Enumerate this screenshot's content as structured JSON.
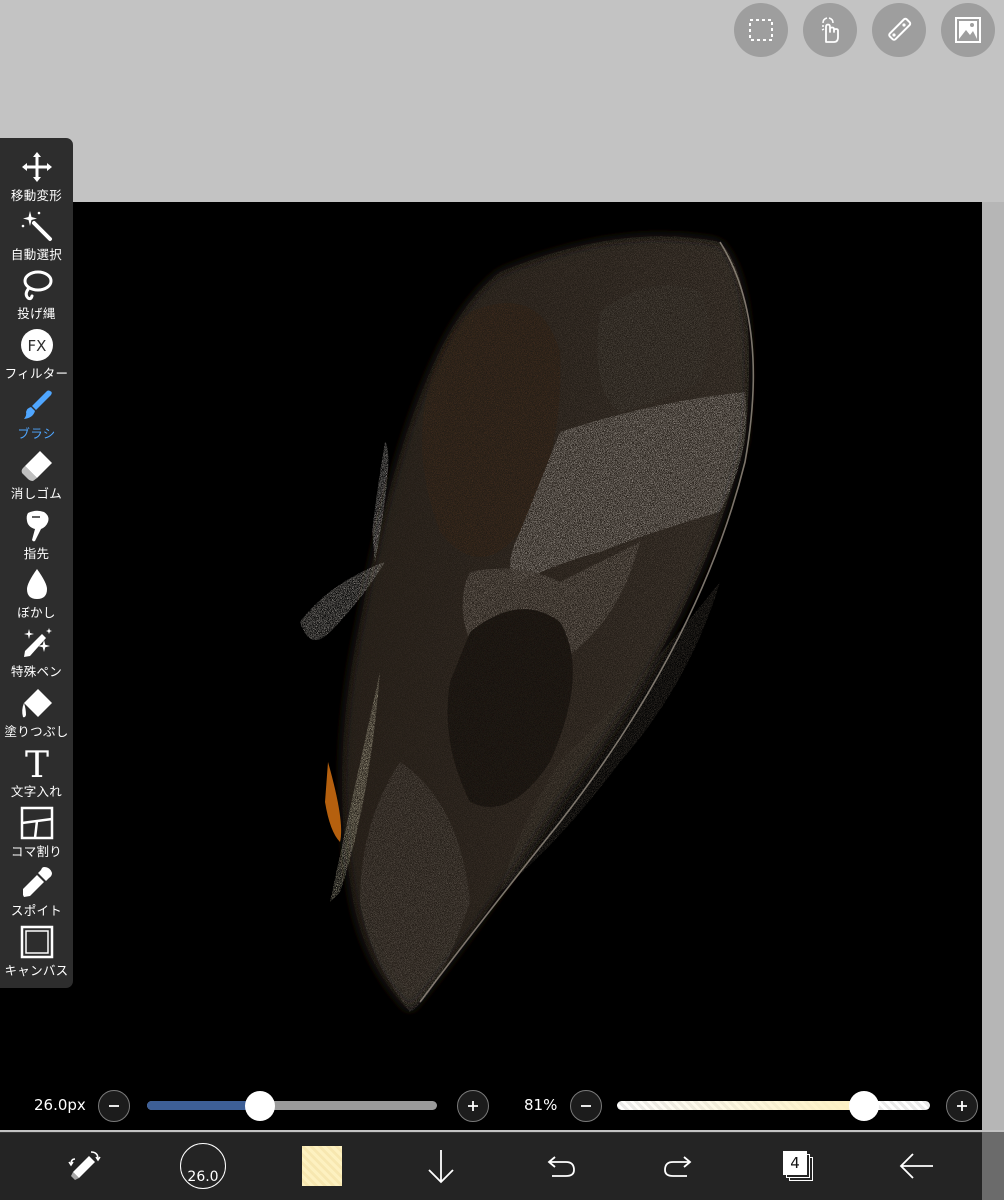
{
  "toolbar": {
    "tools": [
      {
        "id": "move",
        "label": "移動変形",
        "icon": "move-arrows-icon"
      },
      {
        "id": "magic",
        "label": "自動選択",
        "icon": "magic-wand-icon"
      },
      {
        "id": "lasso",
        "label": "投げ縄",
        "icon": "lasso-icon"
      },
      {
        "id": "filter",
        "label": "フィルター",
        "icon": "fx-icon",
        "glyph": "FX"
      },
      {
        "id": "brush",
        "label": "ブラシ",
        "icon": "brush-icon",
        "active": true
      },
      {
        "id": "eraser",
        "label": "消しゴム",
        "icon": "eraser-icon"
      },
      {
        "id": "smudge",
        "label": "指先",
        "icon": "finger-icon"
      },
      {
        "id": "blur",
        "label": "ぼかし",
        "icon": "drop-icon"
      },
      {
        "id": "special",
        "label": "特殊ペン",
        "icon": "sparkle-pen-icon"
      },
      {
        "id": "fill",
        "label": "塗りつぶし",
        "icon": "bucket-icon"
      },
      {
        "id": "text",
        "label": "文字入れ",
        "icon": "text-icon",
        "glyph": "T"
      },
      {
        "id": "panel",
        "label": "コマ割り",
        "icon": "frame-divider-icon"
      },
      {
        "id": "dropper",
        "label": "スポイト",
        "icon": "eyedropper-icon"
      },
      {
        "id": "canvas",
        "label": "キャンバス",
        "icon": "canvas-icon"
      }
    ]
  },
  "top_buttons": [
    {
      "id": "selection",
      "icon": "selection-rect-icon"
    },
    {
      "id": "gesture",
      "icon": "touch-gesture-icon"
    },
    {
      "id": "ruler",
      "icon": "ruler-icon"
    },
    {
      "id": "material",
      "icon": "image-material-icon"
    }
  ],
  "brush_size": {
    "label": "26.0px",
    "value": 26.0,
    "fraction": 0.39
  },
  "opacity": {
    "label": "81%",
    "value": 81,
    "fraction": 0.79
  },
  "bottom_bar": {
    "brush_preview_label": "26.0",
    "layer_count": "4",
    "primary_color": "#fdf1c0",
    "items": [
      "swap-color-icon",
      "brush-size-preview",
      "color-swatch",
      "save-down-icon",
      "undo-icon",
      "redo-icon",
      "layers-icon",
      "back-icon"
    ]
  },
  "colors": {
    "accent": "#4fa6ff",
    "size_fill": "#3d5f97",
    "track": "#9a9a9a",
    "opacity_fill": "#fdf1c0"
  }
}
